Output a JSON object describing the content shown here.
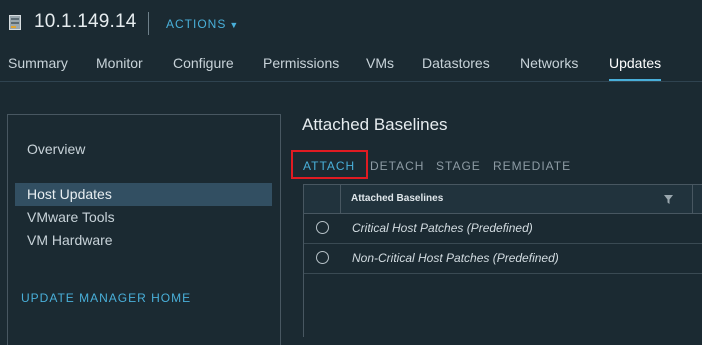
{
  "header": {
    "host_icon": "host-server-icon",
    "title": "10.1.149.14",
    "actions_label": "ACTIONS",
    "actions_caret": "chevron-down-icon"
  },
  "tabs": [
    {
      "label": "Summary",
      "active": false
    },
    {
      "label": "Monitor",
      "active": false
    },
    {
      "label": "Configure",
      "active": false
    },
    {
      "label": "Permissions",
      "active": false
    },
    {
      "label": "VMs",
      "active": false
    },
    {
      "label": "Datastores",
      "active": false
    },
    {
      "label": "Networks",
      "active": false
    },
    {
      "label": "Updates",
      "active": true
    }
  ],
  "nav": {
    "overview": "Overview",
    "items": [
      {
        "label": "Host Updates",
        "active": true
      },
      {
        "label": "VMware Tools",
        "active": false
      },
      {
        "label": "VM Hardware",
        "active": false
      }
    ],
    "home_link": "UPDATE MANAGER HOME"
  },
  "panel": {
    "title": "Attached Baselines",
    "toolbar": [
      {
        "label": "ATTACH",
        "enabled": true,
        "highlighted": true
      },
      {
        "label": "DETACH",
        "enabled": false
      },
      {
        "label": "STAGE",
        "enabled": false
      },
      {
        "label": "REMEDIATE",
        "enabled": false
      }
    ],
    "grid": {
      "column": "Attached Baselines",
      "filter_icon": "filter-icon",
      "rows": [
        {
          "name": "Critical Host Patches (Predefined)",
          "selected": false
        },
        {
          "name": "Non-Critical Host Patches (Predefined)",
          "selected": false
        }
      ]
    }
  },
  "colors": {
    "background": "#1b2a32",
    "accent": "#49afd9",
    "nav_active": "#324f62",
    "highlight_box": "#e01b22"
  }
}
